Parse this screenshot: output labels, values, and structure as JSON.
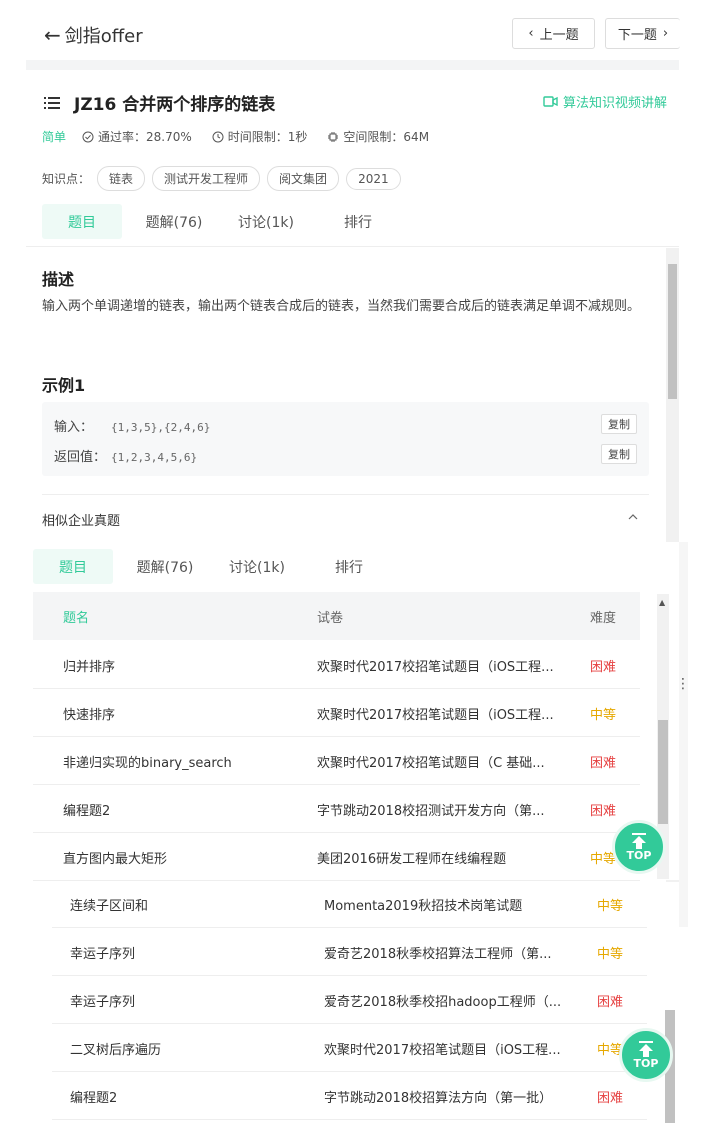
{
  "header": {
    "back_label": "剑指offer",
    "prev_label": "上一题",
    "next_label": "下一题"
  },
  "question": {
    "title": "JZ16  合并两个排序的链表",
    "video_link": "算法知识视频讲解",
    "difficulty": "简单",
    "pass_rate": "通过率：28.70%",
    "time_limit": "时间限制：1秒",
    "space_limit": "空间限制：64M",
    "tags_label": "知识点：",
    "tags": [
      "链表",
      "测试开发工程师",
      "阅文集团",
      "2021"
    ]
  },
  "tabs": [
    "题目",
    "题解(76)",
    "讨论(1k)",
    "排行"
  ],
  "description": {
    "heading": "描述",
    "text": "输入两个单调递增的链表，输出两个链表合成后的链表，当然我们需要合成后的链表满足单调不减规则。"
  },
  "example": {
    "heading": "示例1",
    "input_label": "输入：",
    "input_value": "{1,3,5},{2,4,6}",
    "output_label": "返回值：",
    "output_value": "{1,2,3,4,5,6}",
    "copy_label": "复制"
  },
  "similar": {
    "heading": "相似企业真题",
    "columns": [
      "题名",
      "试卷",
      "难度"
    ],
    "rows_top": [
      {
        "name": "归并排序",
        "paper": "欢聚时代2017校招笔试题目（iOS工程...",
        "level": "困难"
      },
      {
        "name": "快速排序",
        "paper": "欢聚时代2017校招笔试题目（iOS工程...",
        "level": "中等"
      },
      {
        "name": "非递归实现的binary_search",
        "paper": "欢聚时代2017校招笔试题目（C 基础...",
        "level": "困难"
      },
      {
        "name": "编程题2",
        "paper": "字节跳动2018校招测试开发方向（第...",
        "level": "困难"
      },
      {
        "name": "直方图内最大矩形",
        "paper": "美团2016研发工程师在线编程题",
        "level": "中等"
      }
    ],
    "rows_bottom": [
      {
        "name": "连续子区间和",
        "paper": "Momenta2019秋招技术岗笔试题",
        "level": "中等"
      },
      {
        "name": "幸运子序列",
        "paper": "爱奇艺2018秋季校招算法工程师（第...",
        "level": "中等"
      },
      {
        "name": "幸运子序列",
        "paper": "爱奇艺2018秋季校招hadoop工程师（...",
        "level": "困难"
      },
      {
        "name": "二叉树后序遍历",
        "paper": "欢聚时代2017校招笔试题目（iOS工程...",
        "level": "中等"
      },
      {
        "name": "编程题2",
        "paper": "字节跳动2018校招算法方向（第一批）",
        "level": "困难"
      }
    ]
  },
  "top_button_label": "TOP",
  "colors": {
    "accent": "#32ca99",
    "hard": "#e64141",
    "medium": "#e6a800"
  }
}
